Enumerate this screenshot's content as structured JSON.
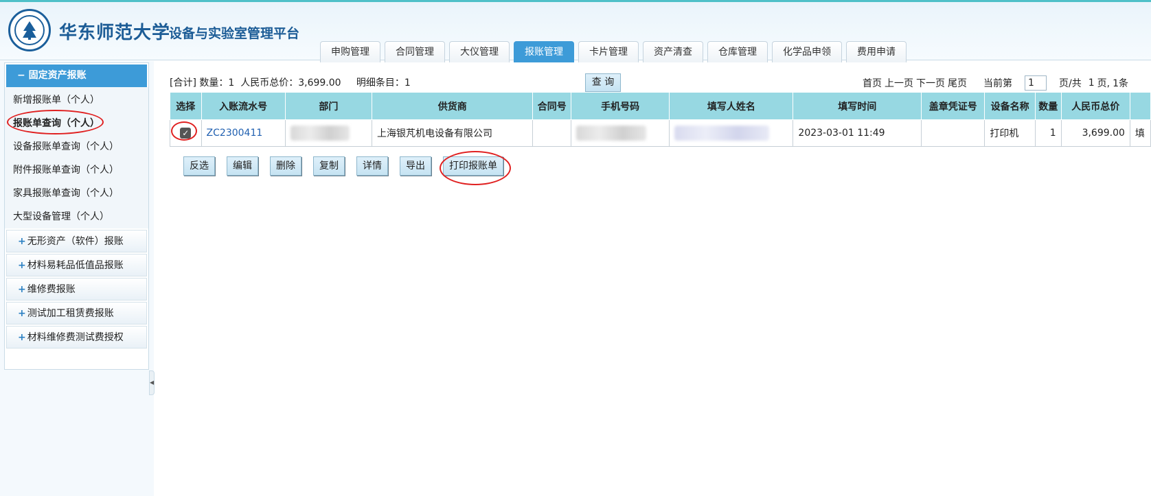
{
  "header": {
    "university": "华东师范大学",
    "platform": "设备与实验室管理平台"
  },
  "tabs": [
    "申购管理",
    "合同管理",
    "大仪管理",
    "报账管理",
    "卡片管理",
    "资产清查",
    "仓库管理",
    "化学品申领",
    "费用申请"
  ],
  "active_tab": "报账管理",
  "sidebar": {
    "section_title": "固定资产报账",
    "items": [
      "新增报账单（个人）",
      "报账单查询（个人）",
      "设备报账单查询（个人）",
      "附件报账单查询（个人）",
      "家具报账单查询（个人）",
      "大型设备管理（个人）"
    ],
    "groups": [
      "无形资产（软件）报账",
      "材料易耗品低值品报账",
      "维修费报账",
      "测试加工租赁费报账",
      "材料维修费测试费授权"
    ]
  },
  "summary": {
    "label_total": "[合计]",
    "qty_label": "数量：",
    "qty": "1",
    "amount_label": "人民币总价：",
    "amount": "3,699.00",
    "detail_label": "明细条目：",
    "detail_count": "1"
  },
  "query_button": "查 询",
  "pager": {
    "first": "首页",
    "prev": "上一页",
    "next": "下一页",
    "last": "尾页",
    "current_label": "当前第",
    "current_page": "1",
    "total_label": "页/共",
    "total_pages": "1",
    "page_unit": "页,",
    "tail": "1条"
  },
  "table": {
    "headers": [
      "选择",
      "入账流水号",
      "部门",
      "供货商",
      "合同号",
      "手机号码",
      "填写人姓名",
      "填写时间",
      "盖章凭证号",
      "设备名称",
      "数量",
      "人民币总价",
      ""
    ],
    "rows": [
      {
        "checked": true,
        "serial": "ZC2300411",
        "supplier": "上海银芃机电设备有限公司",
        "contract": "",
        "time": "2023-03-01 11:49",
        "stamp": "",
        "device": "打印机",
        "qty": "1",
        "total": "3,699.00",
        "extra": "填"
      }
    ]
  },
  "actions": [
    "反选",
    "编辑",
    "删除",
    "复制",
    "详情",
    "导出",
    "打印报账单"
  ]
}
